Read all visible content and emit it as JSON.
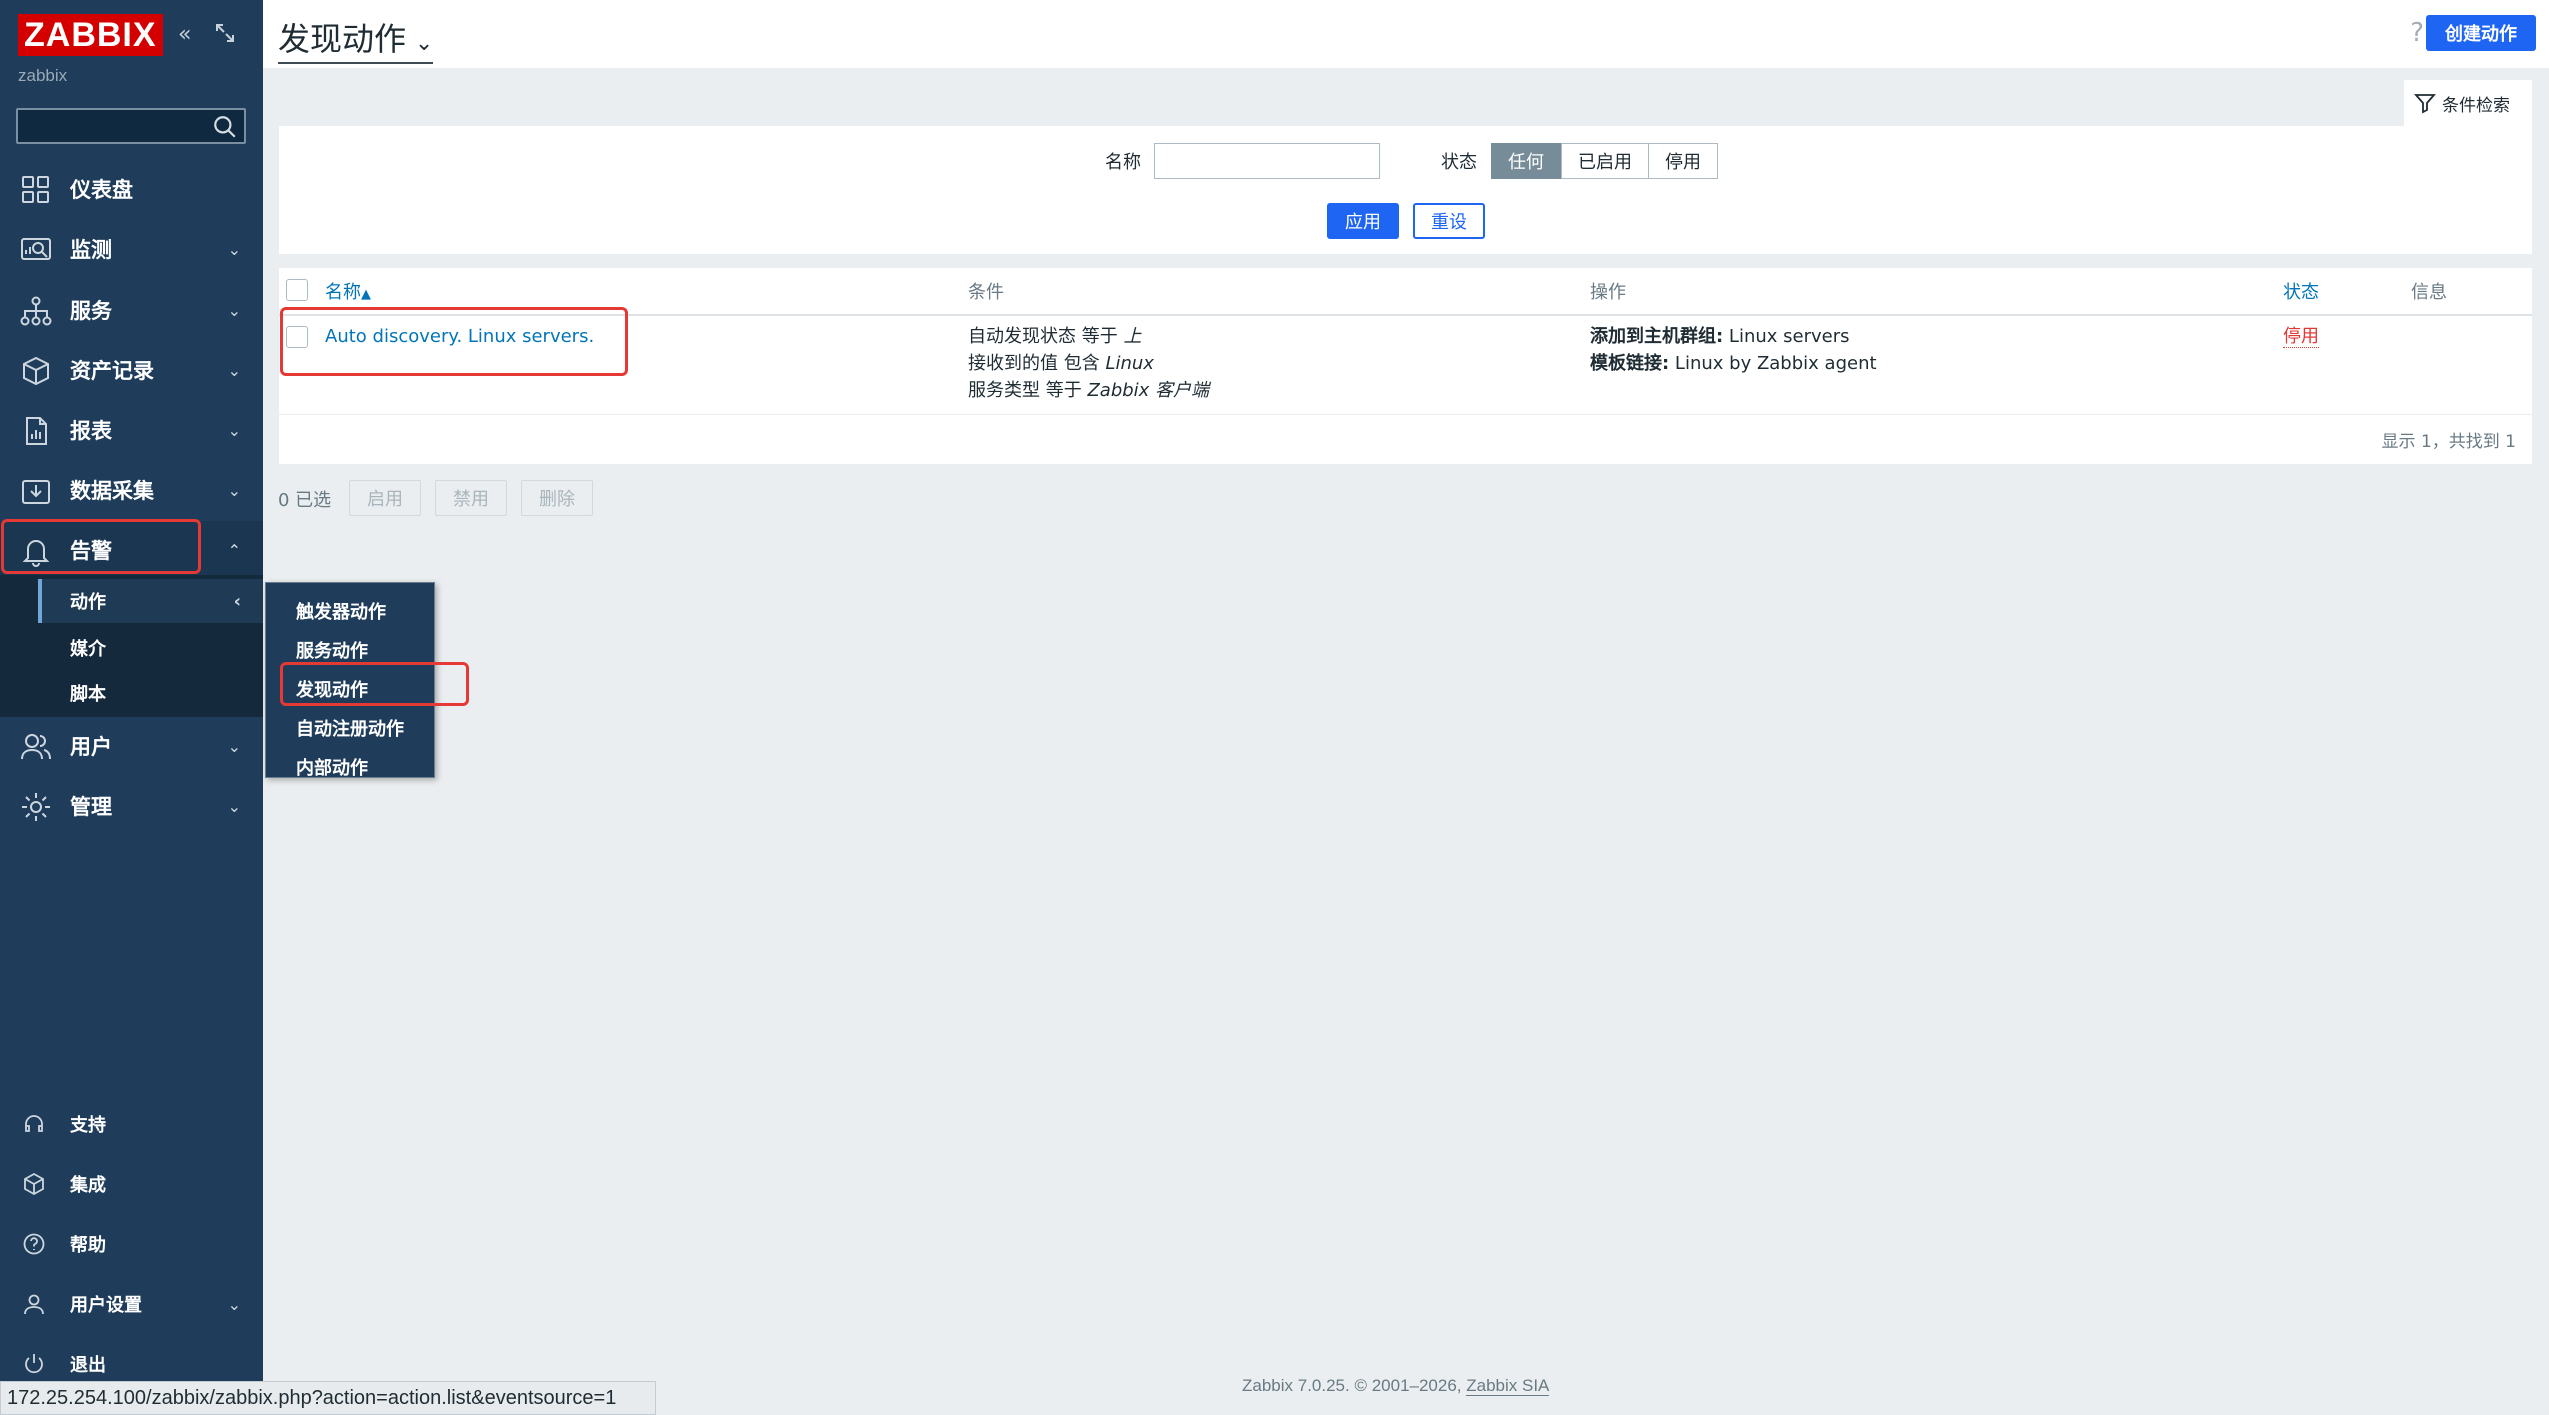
{
  "sidebar": {
    "logo": "ZABBIX",
    "host": "zabbix",
    "search_placeholder": "",
    "menu": [
      {
        "label": "仪表盘"
      },
      {
        "label": "监测"
      },
      {
        "label": "服务"
      },
      {
        "label": "资产记录"
      },
      {
        "label": "报表"
      },
      {
        "label": "数据采集"
      },
      {
        "label": "告警"
      },
      {
        "label": "用户"
      },
      {
        "label": "管理"
      }
    ],
    "alert_submenu": [
      {
        "label": "动作"
      },
      {
        "label": "媒介"
      },
      {
        "label": "脚本"
      }
    ],
    "bottom": [
      {
        "label": "支持"
      },
      {
        "label": "集成"
      },
      {
        "label": "帮助"
      },
      {
        "label": "用户设置"
      },
      {
        "label": "退出"
      }
    ]
  },
  "popup": [
    {
      "label": "触发器动作"
    },
    {
      "label": "服务动作"
    },
    {
      "label": "发现动作"
    },
    {
      "label": "自动注册动作"
    },
    {
      "label": "内部动作"
    }
  ],
  "header": {
    "title": "发现动作",
    "help": "?",
    "create_button": "创建动作"
  },
  "filter": {
    "tab_label": "条件检索",
    "name_label": "名称",
    "name_value": "",
    "status_label": "状态",
    "status_options": [
      "任何",
      "已启用",
      "停用"
    ],
    "status_selected": "任何",
    "apply": "应用",
    "reset": "重设"
  },
  "table": {
    "columns": [
      "名称",
      "条件",
      "操作",
      "状态",
      "信息"
    ],
    "sort_indicator": "▲",
    "rows": [
      {
        "name": "Auto discovery. Linux servers.",
        "conditions": [
          {
            "text": "自动发现状态 等于 ",
            "value": "上"
          },
          {
            "text": "接收到的值 包含 ",
            "value": "Linux"
          },
          {
            "text": "服务类型 等于 ",
            "value": "Zabbix 客户端"
          }
        ],
        "operations": [
          {
            "label": "添加到主机群组:",
            "value": " Linux servers"
          },
          {
            "label": "模板链接:",
            "value": " Linux by Zabbix agent"
          }
        ],
        "status": "停用"
      }
    ],
    "footer": "显示 1，共找到 1"
  },
  "bulk": {
    "selected": "0 已选",
    "buttons": [
      "启用",
      "禁用",
      "删除"
    ]
  },
  "footer": {
    "text": "Zabbix 7.0.25. © 2001–2026, ",
    "link": "Zabbix SIA"
  },
  "statusbar": "172.25.254.100/zabbix/zabbix.php?action=action.list&eventsource=1",
  "colors": {
    "sidebar_bg": "#1f3d5a",
    "primary": "#1f65f4",
    "link": "#0275b8",
    "disabled_status": "#e33734",
    "highlight": "#e53935"
  }
}
